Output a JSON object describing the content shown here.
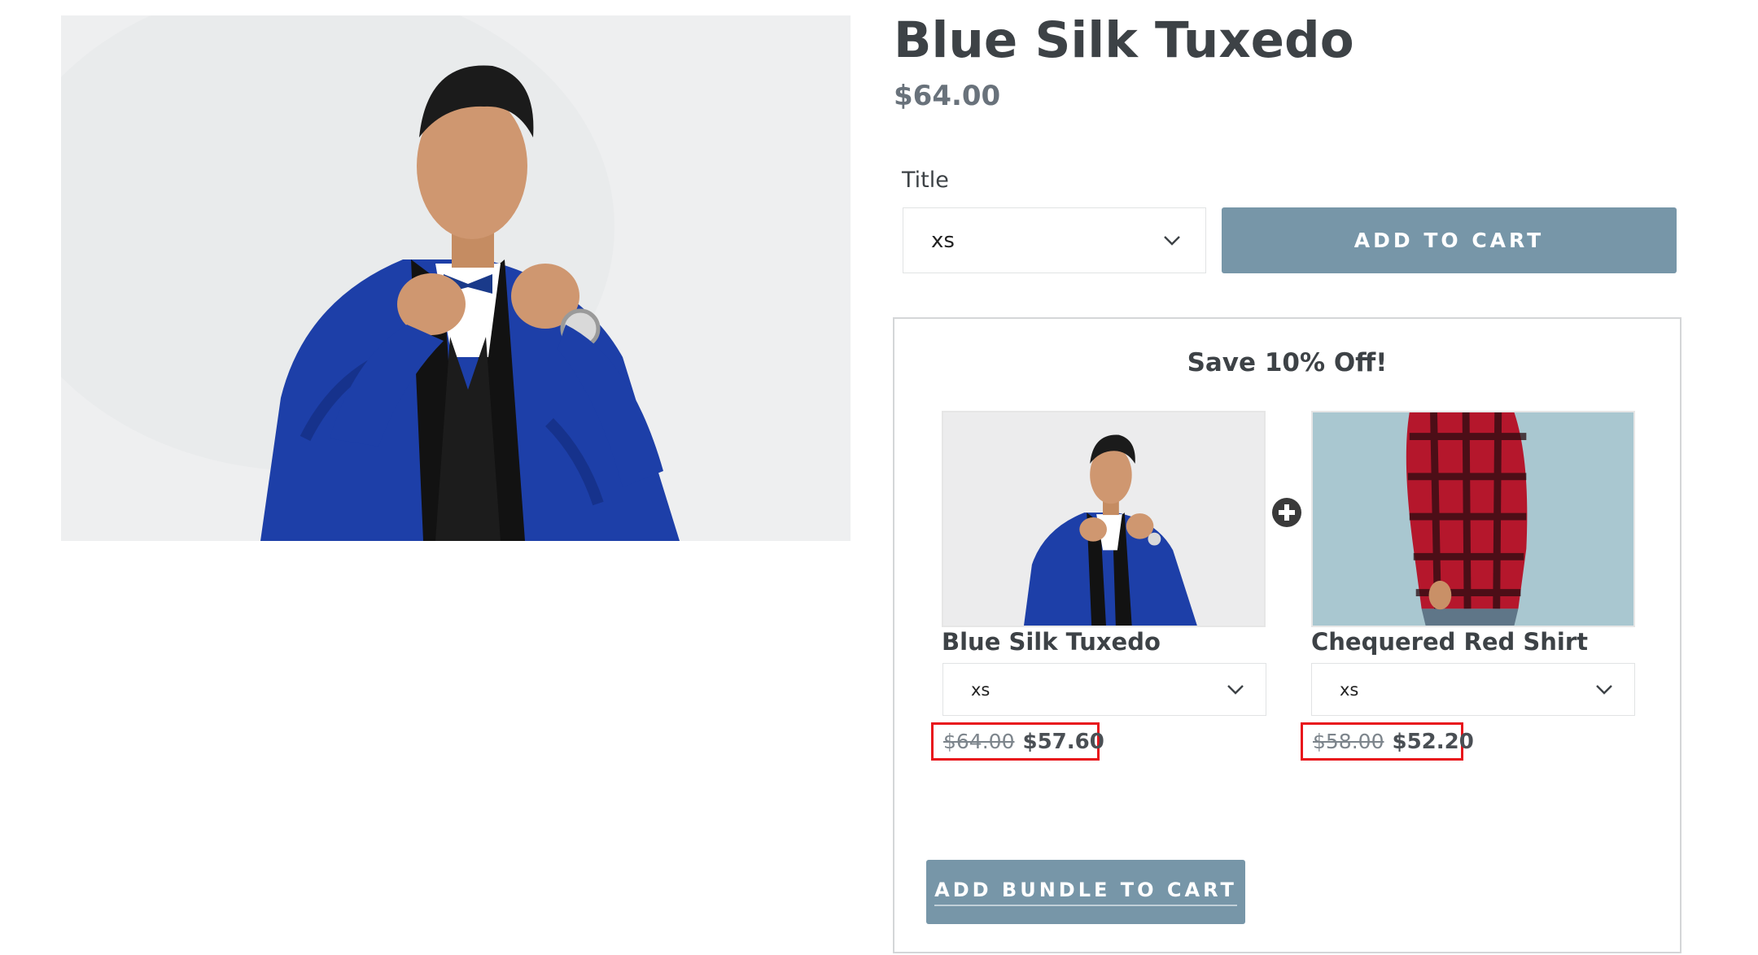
{
  "product": {
    "title": "Blue Silk Tuxedo",
    "price": "$64.00",
    "option_label": "Title",
    "selected_option": "xs",
    "add_to_cart_label": "ADD TO CART",
    "image_icon": "product-photo-man-blue-tuxedo"
  },
  "bundle": {
    "heading": "Save 10% Off!",
    "plus_icon": "plus-circle-icon",
    "items": [
      {
        "name": "Blue Silk Tuxedo",
        "selected_option": "xs",
        "original_price": "$64.00",
        "sale_price": "$57.60",
        "image_icon": "thumb-man-blue-tuxedo"
      },
      {
        "name": "Chequered Red Shirt",
        "selected_option": "xs",
        "original_price": "$58.00",
        "sale_price": "$52.20",
        "image_icon": "thumb-man-red-plaid-shirt"
      }
    ],
    "add_bundle_label": "ADD BUNDLE TO CART"
  },
  "colors": {
    "button": "#7796a8",
    "text": "#3d4246",
    "price_muted": "#69727b",
    "highlight_border": "#e8141b"
  }
}
